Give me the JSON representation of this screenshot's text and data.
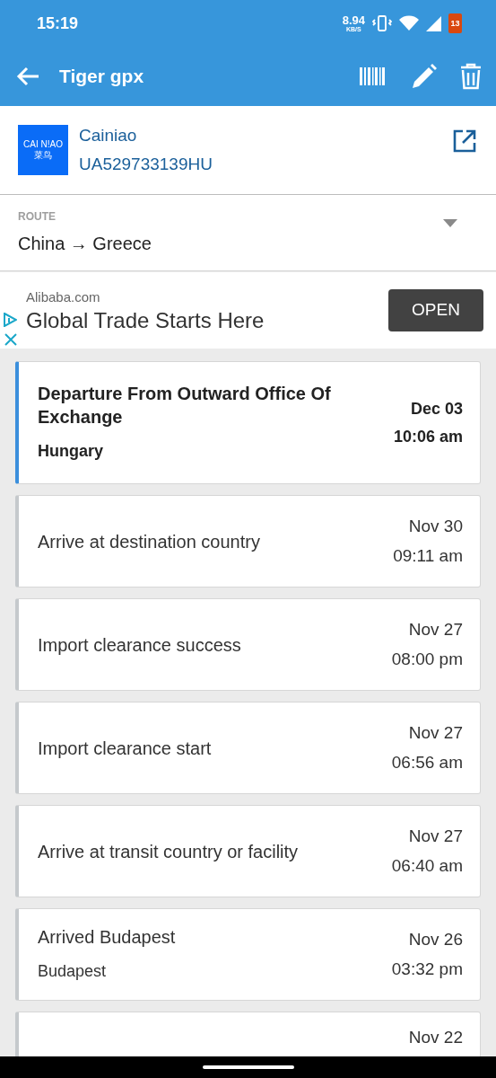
{
  "status_bar": {
    "time": "15:19",
    "net_speed": "8.94",
    "net_unit": "KB/S",
    "battery": "13"
  },
  "toolbar": {
    "title": "Tiger gpx"
  },
  "carrier": {
    "logo_text": "CAI N!AO 菜鸟",
    "name": "Cainiao",
    "tracking_number": "UA529733139HU"
  },
  "route": {
    "label": "ROUTE",
    "value": "China → Greece"
  },
  "ad": {
    "advertiser": "Alibaba.com",
    "headline": "Global Trade Starts Here",
    "button": "OPEN"
  },
  "events": [
    {
      "title": "Departure From Outward Office Of Exchange",
      "location": "Hungary",
      "date": "Dec 03",
      "time": "10:06 am",
      "latest": true
    },
    {
      "title": "Arrive at destination country",
      "date": "Nov 30",
      "time": "09:11 am",
      "latest": false
    },
    {
      "title": "Import clearance success",
      "date": "Nov 27",
      "time": "08:00 pm",
      "latest": false
    },
    {
      "title": "Import clearance start",
      "date": "Nov 27",
      "time": "06:56 am",
      "latest": false
    },
    {
      "title": "Arrive at transit country or facility",
      "date": "Nov 27",
      "time": "06:40 am",
      "latest": false
    },
    {
      "title": "Arrived Budapest",
      "location": "Budapest",
      "date": "Nov 26",
      "time": "03:32 pm",
      "latest": false
    },
    {
      "date": "Nov 22",
      "latest": false
    }
  ]
}
